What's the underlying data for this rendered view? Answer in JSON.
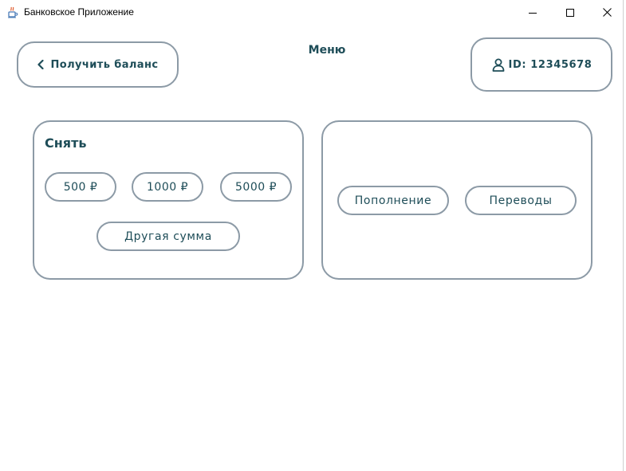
{
  "window": {
    "title": "Банковское Приложение"
  },
  "header": {
    "menu_title": "Меню",
    "balance_button": "Получить баланс",
    "user_id": "ID: 12345678"
  },
  "withdraw": {
    "title": "Снять",
    "amounts": [
      "500 ₽",
      "1000 ₽",
      "5000 ₽"
    ],
    "other_amount": "Другая сумма"
  },
  "actions": {
    "top_up": "Пополнение",
    "transfers": "Переводы"
  },
  "colors": {
    "text": "#1e4d58",
    "border": "#8c9aa6",
    "background": "#ffffff"
  },
  "icons": {
    "app": "java-cup-icon",
    "back": "chevron-left-icon",
    "user": "user-icon"
  }
}
